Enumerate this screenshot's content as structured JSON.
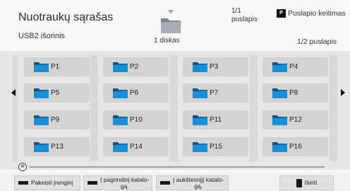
{
  "header": {
    "title": "Nuotraukų sąrašas",
    "device": "USB2 išorinis",
    "source_label": "1 diskas",
    "page_counter_top": [
      "1/1",
      "puslapis"
    ],
    "page_change_key": "P",
    "page_change_label": "Puslapio keitimas",
    "page_counter": "1/2 puslapis"
  },
  "folders": [
    "P1",
    "P2",
    "P3",
    "P4",
    "P5",
    "P6",
    "P7",
    "P8",
    "P9",
    "P10",
    "P11",
    "P12",
    "P13",
    "P14",
    "P15",
    "P16"
  ],
  "footer": {
    "change_device": "Pakeisti įrenginį",
    "main_folder": [
      "Į pagrindinį katalo-",
      "gą."
    ],
    "up_folder": [
      "Į aukštesnįjį katalo-",
      "gą."
    ],
    "exit": "Išeiti"
  },
  "colors": {
    "accent_folder": "#1a8fd6",
    "background": "#f7f7f7",
    "grid_bg": "#e6e6e6",
    "cell_bg": "#d3d3d3"
  },
  "icons": {
    "folder": "folder-icon",
    "left": "arrow-left-icon",
    "right": "arrow-right-icon",
    "scroll": "scroll-icon",
    "exit": "exit-door-icon"
  }
}
